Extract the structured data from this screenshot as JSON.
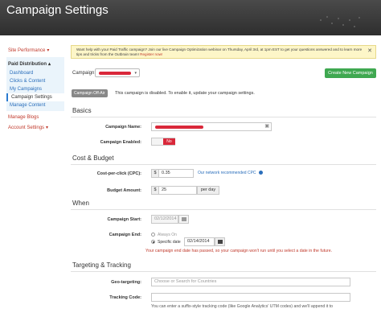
{
  "header": {
    "title": "Campaign Settings"
  },
  "sidebar": {
    "site_performance": "Site Performance",
    "paid_distribution": "Paid Distribution",
    "items": [
      "Dashboard",
      "Clicks & Content",
      "My Campaigns",
      "Campaign Settings",
      "Manage Content"
    ],
    "manage_blogs": "Manage Blogs",
    "account_settings": "Account Settings"
  },
  "notice": {
    "text": "Want help with your Paid Traffic campaign? Join our live Campaign Optimization webinar on Thursday, April 3rd, at 1pm EST to get your questions answered and to learn more tips and tricks from the Outbrain team!",
    "link": "Register now!"
  },
  "campaign_select": {
    "label": "Campaign:"
  },
  "create_button": "Create New Campaign",
  "off_air": {
    "badge": "Campaign Off-Air",
    "message": "This campaign is disabled. To enable it, update your campaign settings."
  },
  "basics": {
    "title": "Basics",
    "name_label": "Campaign Name:",
    "enabled_label": "Campaign Enabled:",
    "enabled_value": "No"
  },
  "cost": {
    "title": "Cost & Budget",
    "cpc_label": "Cost-per-click (CPC):",
    "currency": "$",
    "cpc_value": "0.35",
    "recommended": "Our network recommended CPC",
    "budget_label": "Budget Amount:",
    "budget_value": "25",
    "per_day": "per day"
  },
  "when": {
    "title": "When",
    "start_label": "Campaign Start:",
    "start_value": "02/12/2014",
    "end_label": "Campaign End:",
    "always_on": "Always On",
    "specific_date": "Specific date",
    "end_value": "02/14/2014",
    "error": "Your campaign end date has passed, so your campaign won't run until you select a date in the future."
  },
  "targeting": {
    "title": "Targeting & Tracking",
    "geo_label": "Geo-targeting:",
    "geo_placeholder": "Choose or Search for Countries",
    "tracking_label": "Tracking Code:",
    "tracking_note": "You can enter a suffix-style tracking code (like Google Analytics' UTM codes) and we'll append it to"
  }
}
